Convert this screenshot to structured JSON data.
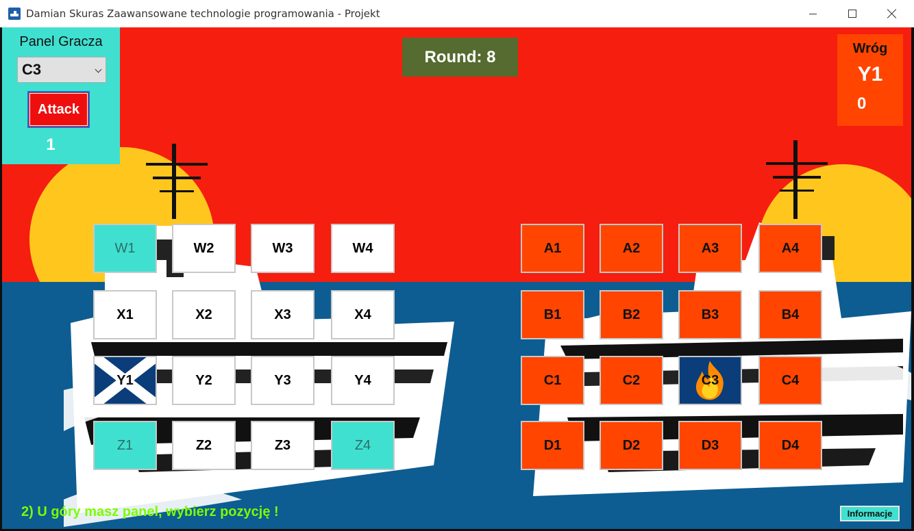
{
  "window": {
    "title": "Damian Skuras Zaawansowane technologie programowania - Projekt"
  },
  "player_panel": {
    "title": "Panel Gracza",
    "selected_position": "C3",
    "attack_label": "Attack",
    "shots": "1"
  },
  "round": {
    "text": "Round: 8"
  },
  "enemy_panel": {
    "title": "Wróg",
    "last_target": "Y1",
    "count": "0"
  },
  "player_board": [
    [
      {
        "label": "W1",
        "state": "turquoise"
      },
      {
        "label": "W2",
        "state": "white"
      },
      {
        "label": "W3",
        "state": "white"
      },
      {
        "label": "W4",
        "state": "white"
      }
    ],
    [
      {
        "label": "X1",
        "state": "white"
      },
      {
        "label": "X2",
        "state": "white"
      },
      {
        "label": "X3",
        "state": "white"
      },
      {
        "label": "X4",
        "state": "white"
      }
    ],
    [
      {
        "label": "Y1",
        "state": "miss-cross"
      },
      {
        "label": "Y2",
        "state": "white"
      },
      {
        "label": "Y3",
        "state": "white"
      },
      {
        "label": "Y4",
        "state": "white"
      }
    ],
    [
      {
        "label": "Z1",
        "state": "turquoise"
      },
      {
        "label": "Z2",
        "state": "white"
      },
      {
        "label": "Z3",
        "state": "white"
      },
      {
        "label": "Z4",
        "state": "turquoise"
      }
    ]
  ],
  "enemy_board": [
    [
      {
        "label": "A1",
        "state": "orange"
      },
      {
        "label": "A2",
        "state": "orange"
      },
      {
        "label": "A3",
        "state": "orange"
      },
      {
        "label": "A4",
        "state": "orange"
      }
    ],
    [
      {
        "label": "B1",
        "state": "orange"
      },
      {
        "label": "B2",
        "state": "orange"
      },
      {
        "label": "B3",
        "state": "orange"
      },
      {
        "label": "B4",
        "state": "orange"
      }
    ],
    [
      {
        "label": "C1",
        "state": "orange"
      },
      {
        "label": "C2",
        "state": "orange"
      },
      {
        "label": "C3",
        "state": "hit-fire"
      },
      {
        "label": "C4",
        "state": "orange"
      }
    ],
    [
      {
        "label": "D1",
        "state": "orange"
      },
      {
        "label": "D2",
        "state": "orange"
      },
      {
        "label": "D3",
        "state": "orange"
      },
      {
        "label": "D4",
        "state": "orange"
      }
    ]
  ],
  "hint": "2) U góry masz panel, wybierz pozycję !",
  "info_button": "Informacje",
  "colors": {
    "sky": "#f51e0f",
    "sea": "#0d5d92",
    "sun": "#ffc71d",
    "turquoise": "#40e0d0",
    "enemy_orange": "#ff4500",
    "round_bg": "#556b2f",
    "hint_green": "#7cfc00"
  },
  "icons": {
    "miss": "white-x-on-navy",
    "hit": "fire-icon"
  }
}
